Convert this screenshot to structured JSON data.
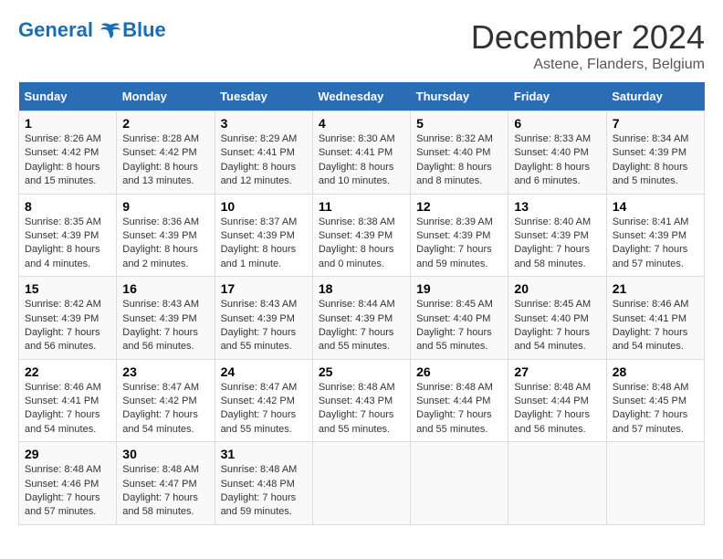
{
  "header": {
    "logo_line1": "General",
    "logo_line2": "Blue",
    "month_title": "December 2024",
    "subtitle": "Astene, Flanders, Belgium"
  },
  "weekdays": [
    "Sunday",
    "Monday",
    "Tuesday",
    "Wednesday",
    "Thursday",
    "Friday",
    "Saturday"
  ],
  "weeks": [
    [
      {
        "day": "1",
        "sunrise": "Sunrise: 8:26 AM",
        "sunset": "Sunset: 4:42 PM",
        "daylight": "Daylight: 8 hours and 15 minutes."
      },
      {
        "day": "2",
        "sunrise": "Sunrise: 8:28 AM",
        "sunset": "Sunset: 4:42 PM",
        "daylight": "Daylight: 8 hours and 13 minutes."
      },
      {
        "day": "3",
        "sunrise": "Sunrise: 8:29 AM",
        "sunset": "Sunset: 4:41 PM",
        "daylight": "Daylight: 8 hours and 12 minutes."
      },
      {
        "day": "4",
        "sunrise": "Sunrise: 8:30 AM",
        "sunset": "Sunset: 4:41 PM",
        "daylight": "Daylight: 8 hours and 10 minutes."
      },
      {
        "day": "5",
        "sunrise": "Sunrise: 8:32 AM",
        "sunset": "Sunset: 4:40 PM",
        "daylight": "Daylight: 8 hours and 8 minutes."
      },
      {
        "day": "6",
        "sunrise": "Sunrise: 8:33 AM",
        "sunset": "Sunset: 4:40 PM",
        "daylight": "Daylight: 8 hours and 6 minutes."
      },
      {
        "day": "7",
        "sunrise": "Sunrise: 8:34 AM",
        "sunset": "Sunset: 4:39 PM",
        "daylight": "Daylight: 8 hours and 5 minutes."
      }
    ],
    [
      {
        "day": "8",
        "sunrise": "Sunrise: 8:35 AM",
        "sunset": "Sunset: 4:39 PM",
        "daylight": "Daylight: 8 hours and 4 minutes."
      },
      {
        "day": "9",
        "sunrise": "Sunrise: 8:36 AM",
        "sunset": "Sunset: 4:39 PM",
        "daylight": "Daylight: 8 hours and 2 minutes."
      },
      {
        "day": "10",
        "sunrise": "Sunrise: 8:37 AM",
        "sunset": "Sunset: 4:39 PM",
        "daylight": "Daylight: 8 hours and 1 minute."
      },
      {
        "day": "11",
        "sunrise": "Sunrise: 8:38 AM",
        "sunset": "Sunset: 4:39 PM",
        "daylight": "Daylight: 8 hours and 0 minutes."
      },
      {
        "day": "12",
        "sunrise": "Sunrise: 8:39 AM",
        "sunset": "Sunset: 4:39 PM",
        "daylight": "Daylight: 7 hours and 59 minutes."
      },
      {
        "day": "13",
        "sunrise": "Sunrise: 8:40 AM",
        "sunset": "Sunset: 4:39 PM",
        "daylight": "Daylight: 7 hours and 58 minutes."
      },
      {
        "day": "14",
        "sunrise": "Sunrise: 8:41 AM",
        "sunset": "Sunset: 4:39 PM",
        "daylight": "Daylight: 7 hours and 57 minutes."
      }
    ],
    [
      {
        "day": "15",
        "sunrise": "Sunrise: 8:42 AM",
        "sunset": "Sunset: 4:39 PM",
        "daylight": "Daylight: 7 hours and 56 minutes."
      },
      {
        "day": "16",
        "sunrise": "Sunrise: 8:43 AM",
        "sunset": "Sunset: 4:39 PM",
        "daylight": "Daylight: 7 hours and 56 minutes."
      },
      {
        "day": "17",
        "sunrise": "Sunrise: 8:43 AM",
        "sunset": "Sunset: 4:39 PM",
        "daylight": "Daylight: 7 hours and 55 minutes."
      },
      {
        "day": "18",
        "sunrise": "Sunrise: 8:44 AM",
        "sunset": "Sunset: 4:39 PM",
        "daylight": "Daylight: 7 hours and 55 minutes."
      },
      {
        "day": "19",
        "sunrise": "Sunrise: 8:45 AM",
        "sunset": "Sunset: 4:40 PM",
        "daylight": "Daylight: 7 hours and 55 minutes."
      },
      {
        "day": "20",
        "sunrise": "Sunrise: 8:45 AM",
        "sunset": "Sunset: 4:40 PM",
        "daylight": "Daylight: 7 hours and 54 minutes."
      },
      {
        "day": "21",
        "sunrise": "Sunrise: 8:46 AM",
        "sunset": "Sunset: 4:41 PM",
        "daylight": "Daylight: 7 hours and 54 minutes."
      }
    ],
    [
      {
        "day": "22",
        "sunrise": "Sunrise: 8:46 AM",
        "sunset": "Sunset: 4:41 PM",
        "daylight": "Daylight: 7 hours and 54 minutes."
      },
      {
        "day": "23",
        "sunrise": "Sunrise: 8:47 AM",
        "sunset": "Sunset: 4:42 PM",
        "daylight": "Daylight: 7 hours and 54 minutes."
      },
      {
        "day": "24",
        "sunrise": "Sunrise: 8:47 AM",
        "sunset": "Sunset: 4:42 PM",
        "daylight": "Daylight: 7 hours and 55 minutes."
      },
      {
        "day": "25",
        "sunrise": "Sunrise: 8:48 AM",
        "sunset": "Sunset: 4:43 PM",
        "daylight": "Daylight: 7 hours and 55 minutes."
      },
      {
        "day": "26",
        "sunrise": "Sunrise: 8:48 AM",
        "sunset": "Sunset: 4:44 PM",
        "daylight": "Daylight: 7 hours and 55 minutes."
      },
      {
        "day": "27",
        "sunrise": "Sunrise: 8:48 AM",
        "sunset": "Sunset: 4:44 PM",
        "daylight": "Daylight: 7 hours and 56 minutes."
      },
      {
        "day": "28",
        "sunrise": "Sunrise: 8:48 AM",
        "sunset": "Sunset: 4:45 PM",
        "daylight": "Daylight: 7 hours and 57 minutes."
      }
    ],
    [
      {
        "day": "29",
        "sunrise": "Sunrise: 8:48 AM",
        "sunset": "Sunset: 4:46 PM",
        "daylight": "Daylight: 7 hours and 57 minutes."
      },
      {
        "day": "30",
        "sunrise": "Sunrise: 8:48 AM",
        "sunset": "Sunset: 4:47 PM",
        "daylight": "Daylight: 7 hours and 58 minutes."
      },
      {
        "day": "31",
        "sunrise": "Sunrise: 8:48 AM",
        "sunset": "Sunset: 4:48 PM",
        "daylight": "Daylight: 7 hours and 59 minutes."
      },
      null,
      null,
      null,
      null
    ]
  ]
}
